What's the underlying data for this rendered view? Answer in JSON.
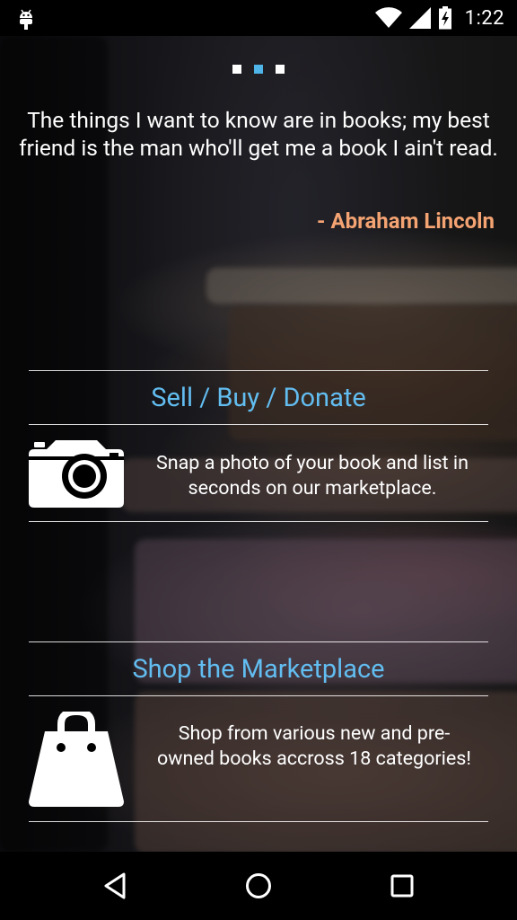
{
  "status_bar": {
    "time": "1:22",
    "icons": [
      "android-debug-icon",
      "wifi-icon",
      "cell-signal-icon",
      "battery-charging-icon"
    ]
  },
  "pager": {
    "dot_count": 3,
    "active_index": 1,
    "active_color": "#4fb4e8"
  },
  "quote": {
    "text": "The things I want to know are in books; my best friend is the man who'll get me a book I ain't read.",
    "author": "- Abraham Lincoln",
    "author_color": "#f4a372"
  },
  "features": [
    {
      "title": "Sell / Buy / Donate",
      "icon": "camera-icon",
      "description": "Snap a photo of your book and list in seconds on our marketplace."
    },
    {
      "title": "Shop the Marketplace",
      "icon": "shopping-bag-icon",
      "description": "Shop from various new and pre-owned books accross 18 categories!"
    }
  ],
  "colors": {
    "accent": "#62bdf0"
  },
  "nav_bar": {
    "buttons": [
      "back-icon",
      "home-icon",
      "recents-icon"
    ]
  }
}
